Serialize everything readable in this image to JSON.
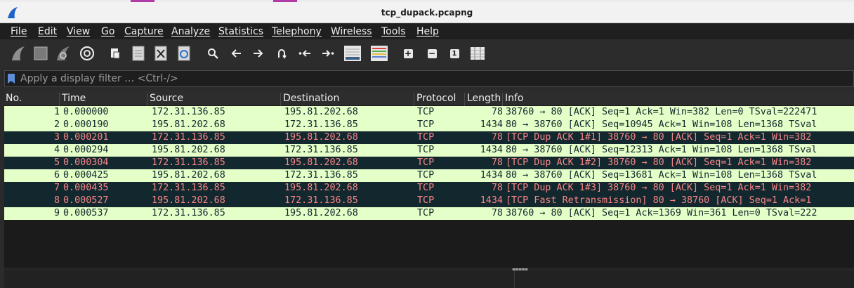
{
  "window": {
    "title": "tcp_dupack.pcapng"
  },
  "menu": [
    "File",
    "Edit",
    "View",
    "Go",
    "Capture",
    "Analyze",
    "Statistics",
    "Telephony",
    "Wireless",
    "Tools",
    "Help"
  ],
  "toolbar": {
    "icons": [
      "start-capture-icon",
      "stop-capture-icon",
      "restart-capture-icon",
      "capture-options-icon",
      "open-file-icon",
      "save-file-icon",
      "close-file-icon",
      "reload-file-icon",
      "find-packet-icon",
      "go-back-icon",
      "go-forward-icon",
      "go-to-packet-icon",
      "first-packet-icon",
      "last-packet-icon",
      "autoscroll-icon",
      "colorize-icon",
      "zoom-in-icon",
      "zoom-out-icon",
      "normal-size-icon",
      "resize-columns-icon"
    ],
    "zoom_in_glyph": "+",
    "zoom_out_glyph": "−",
    "normal_size_glyph": "1"
  },
  "filter": {
    "placeholder": "Apply a display filter … <Ctrl-/>",
    "value": ""
  },
  "columns": [
    "No.",
    "Time",
    "Source",
    "Destination",
    "Protocol",
    "Length",
    "Info"
  ],
  "packets": [
    {
      "no": "1",
      "time": "0.000000",
      "src": "172.31.136.85",
      "dst": "195.81.202.68",
      "proto": "TCP",
      "len": "78",
      "info": "38760 → 80 [ACK] Seq=1 Ack=1 Win=382 Len=0 TSval=222471",
      "style": "ok"
    },
    {
      "no": "2",
      "time": "0.000190",
      "src": "195.81.202.68",
      "dst": "172.31.136.85",
      "proto": "TCP",
      "len": "1434",
      "info": "80 → 38760 [ACK] Seq=10945 Ack=1 Win=108 Len=1368 TSval",
      "style": "ok"
    },
    {
      "no": "3",
      "time": "0.000201",
      "src": "172.31.136.85",
      "dst": "195.81.202.68",
      "proto": "TCP",
      "len": "78",
      "info": "[TCP Dup ACK 1#1] 38760 → 80 [ACK] Seq=1 Ack=1 Win=382",
      "style": "bad"
    },
    {
      "no": "4",
      "time": "0.000294",
      "src": "195.81.202.68",
      "dst": "172.31.136.85",
      "proto": "TCP",
      "len": "1434",
      "info": "80 → 38760 [ACK] Seq=12313 Ack=1 Win=108 Len=1368 TSval",
      "style": "ok"
    },
    {
      "no": "5",
      "time": "0.000304",
      "src": "172.31.136.85",
      "dst": "195.81.202.68",
      "proto": "TCP",
      "len": "78",
      "info": "[TCP Dup ACK 1#2] 38760 → 80 [ACK] Seq=1 Ack=1 Win=382",
      "style": "bad"
    },
    {
      "no": "6",
      "time": "0.000425",
      "src": "195.81.202.68",
      "dst": "172.31.136.85",
      "proto": "TCP",
      "len": "1434",
      "info": "80 → 38760 [ACK] Seq=13681 Ack=1 Win=108 Len=1368 TSval",
      "style": "ok"
    },
    {
      "no": "7",
      "time": "0.000435",
      "src": "172.31.136.85",
      "dst": "195.81.202.68",
      "proto": "TCP",
      "len": "78",
      "info": "[TCP Dup ACK 1#3] 38760 → 80 [ACK] Seq=1 Ack=1 Win=382",
      "style": "bad"
    },
    {
      "no": "8",
      "time": "0.000527",
      "src": "195.81.202.68",
      "dst": "172.31.136.85",
      "proto": "TCP",
      "len": "1434",
      "info": "[TCP Fast Retransmission] 80 → 38760 [ACK] Seq=1 Ack=1",
      "style": "bad"
    },
    {
      "no": "9",
      "time": "0.000537",
      "src": "172.31.136.85",
      "dst": "195.81.202.68",
      "proto": "TCP",
      "len": "78",
      "info": "38760 → 80 [ACK] Seq=1 Ack=1369 Win=361 Len=0 TSval=222",
      "style": "ok"
    }
  ],
  "colors": {
    "ok_bg": "#e4ffc7",
    "ok_fg": "#12272e",
    "bad_bg": "#12272e",
    "bad_fg": "#f78787",
    "accent": "#1e64c8"
  }
}
